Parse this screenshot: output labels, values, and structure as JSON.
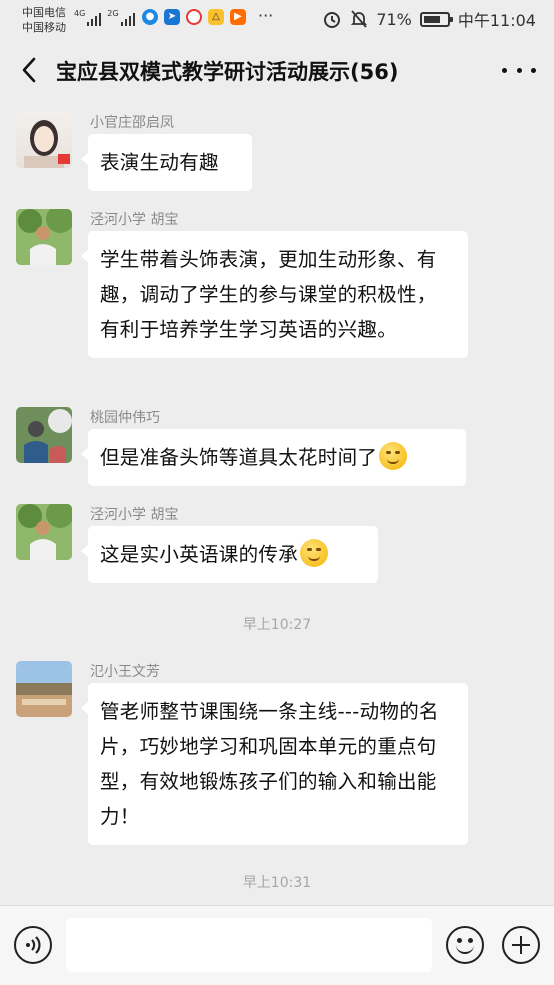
{
  "status_bar": {
    "carrier_1": "中国电信",
    "carrier_2": "中国移动",
    "network_1": "4G",
    "network_2": "2G",
    "more_icon": "···",
    "battery": "71%",
    "time": "中午11:04"
  },
  "header": {
    "title": "宝应县双模式教学研讨活动展示(56)"
  },
  "messages": [
    {
      "sender": "小官庄邵启凤",
      "text": "表演生动有趣",
      "emoji": ""
    },
    {
      "sender": "泾河小学 胡宝",
      "text": "学生带着头饰表演，更加生动形象、有趣，调动了学生的参与课堂的积极性，有利于培养学生学习英语的兴趣。",
      "emoji": ""
    },
    {
      "sender": "桃园仲伟巧",
      "text": "但是准备头饰等道具太花时间了",
      "emoji": "laughing-tears-emoji"
    },
    {
      "sender": "泾河小学 胡宝",
      "text": "这是实小英语课的传承",
      "emoji": "thinking-emoji"
    },
    {
      "sender": "氾小王文芳",
      "text": "管老师整节课围绕一条主线---动物的名片，巧妙地学习和巩固本单元的重点句型，有效地锻炼孩子们的输入和输出能力！",
      "emoji": ""
    }
  ],
  "timestamps": [
    "早上10:27",
    "早上10:31"
  ],
  "input_bar": {
    "voice_icon": "voice-icon",
    "text_value": "",
    "emoji_icon": "emoji-icon",
    "plus_icon": "plus-icon"
  },
  "colors": {
    "background": "#ededed",
    "bubble": "#ffffff",
    "sender_text": "#8a8a8a"
  }
}
